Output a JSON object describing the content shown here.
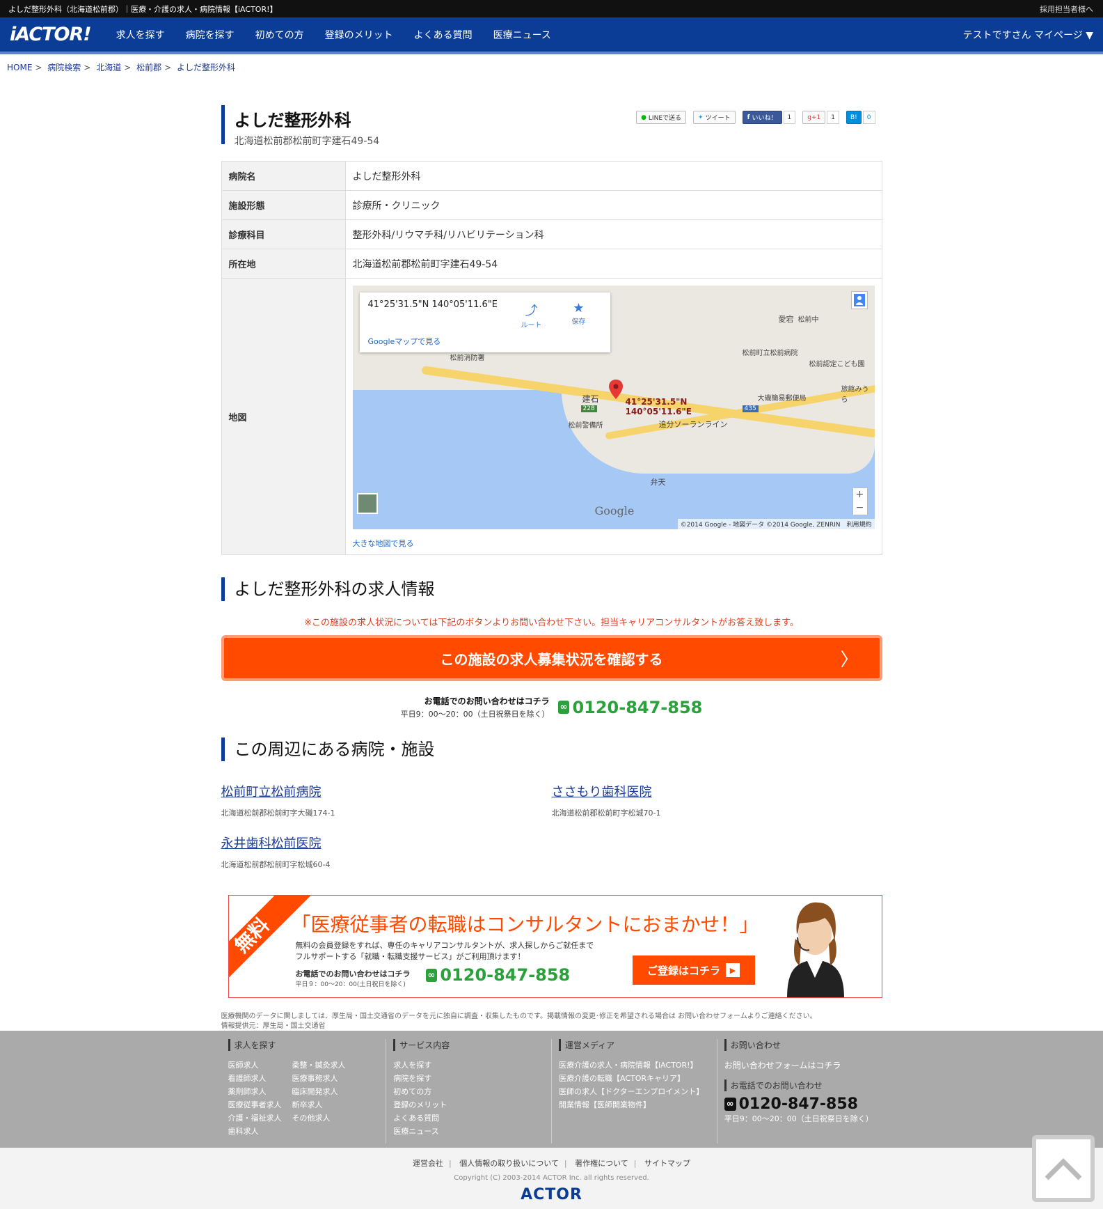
{
  "topbar": {
    "title": "よしだ整形外科（北海道松前郡）｜医療・介護の求人・病院情報【iACTOR!】",
    "employer_link": "採用担当者様へ"
  },
  "header": {
    "logo": "iACTOR!",
    "nav": [
      "求人を探す",
      "病院を探す",
      "初めての方",
      "登録のメリット",
      "よくある質問",
      "医療ニュース"
    ],
    "user_menu": "テストですさん マイページ ▼"
  },
  "breadcrumb": [
    "HOME",
    "病院検索",
    "北海道",
    "松前郡",
    "よしだ整形外科"
  ],
  "share": {
    "line": "LINEで送る",
    "tweet": "ツイート",
    "like": "いいね！",
    "like_count": "1",
    "gplus": "g+1",
    "gplus_count": "1",
    "hatena": "B!",
    "hatena_count": "0"
  },
  "hospital": {
    "name": "よしだ整形外科",
    "address": "北海道松前郡松前町字建石49-54"
  },
  "info_table": {
    "rows": [
      {
        "label": "病院名",
        "value": "よしだ整形外科"
      },
      {
        "label": "施設形態",
        "value": "診療所・クリニック"
      },
      {
        "label": "診療科目",
        "value": "整形外科/リウマチ科/リハビリテーション科"
      },
      {
        "label": "所在地",
        "value": "北海道松前郡松前町字建石49-54"
      }
    ],
    "map_label": "地図"
  },
  "map": {
    "coord": "41°25'31.5\"N 140°05'11.6\"E",
    "pin_line1": "41°25'31.5\"N",
    "pin_line2": "140°05'11.6\"E",
    "route": "ルート",
    "save": "保存",
    "google_link": "Googleマップで見る",
    "google": "Google",
    "copyright": "©2014 Google - 地図データ ©2014 Google, ZENRIN　利用規約",
    "big_map_link": "大きな地図で見る",
    "places": [
      "松前消防署",
      "建石",
      "228",
      "松前警備所",
      "追分ソーランライン",
      "大磯簡易郵便局",
      "435",
      "愛宕",
      "松前中",
      "松前町立松前病院",
      "松前認定こども園",
      "旅館みうら",
      "弁天"
    ]
  },
  "jobs": {
    "title": "よしだ整形外科の求人情報",
    "notice": "※この施設の求人状況については下記のボタンよりお問い合わせ下さい。担当キャリアコンサルタントがお答え致します。",
    "cta": "この施設の求人募集状況を確認する",
    "phone_label": "お電話でのお問い合わせはコチラ",
    "phone_hours": "平日9：00～20：00（土日祝祭日を除く）",
    "phone_number": "0120-847-858",
    "freedial": "∞"
  },
  "nearby": {
    "title": "この周辺にある病院・施設",
    "items": [
      {
        "name": "松前町立松前病院",
        "address": "北海道松前郡松前町字大磯174-1"
      },
      {
        "name": "ささもり歯科医院",
        "address": "北海道松前郡松前町字松城70-1"
      },
      {
        "name": "永井歯科松前医院",
        "address": "北海道松前郡松前町字松城60-4"
      }
    ]
  },
  "banner": {
    "ribbon": "無料",
    "headline": "「医療従事者の転職はコンサルタントにおまかせ！」",
    "desc1": "無料の会員登録をすれば、専任のキャリアコンサルタントが、求人探しからご就任まで",
    "desc2": "フルサポートする「就職・転職支援サービス」がご利用頂けます！",
    "phone_label": "お電話でのお問い合わせはコチラ",
    "phone_hours": "平日９：00～20：00(土日祝日を除く)",
    "phone_number": "0120-847-858",
    "register": "ご登録はコチラ"
  },
  "disclaimer": {
    "line1": "医療機関のデータに関しましては、厚生局・国土交通省のデータを元に独自に調査・収集したものです。掲載情報の変更･修正を希望される場合は お問い合わせフォームよりご連絡ください。",
    "line2": "情報提供元：厚生局・国土交通省"
  },
  "footer": {
    "col1": {
      "title": "求人を探す",
      "links": [
        "医師求人",
        "柔整・鍼灸求人",
        "看護師求人",
        "医療事務求人",
        "薬剤師求人",
        "臨床開発求人",
        "医療従事者求人",
        "新卒求人",
        "介護・福祉求人",
        "その他求人",
        "歯科求人"
      ]
    },
    "col2": {
      "title": "サービス内容",
      "links": [
        "求人を探す",
        "病院を探す",
        "初めての方",
        "登録のメリット",
        "よくある質問",
        "医療ニュース"
      ]
    },
    "col3": {
      "title": "運営メディア",
      "links": [
        "医療介護の求人・病院情報【iACTOR!】",
        "医療介護の転職【ACTORキャリア】",
        "医師の求人【ドクターエンプロイメント】",
        "開業情報【医師開業物件】"
      ]
    },
    "col4": {
      "title": "お問い合わせ",
      "form_link": "お問い合わせフォームはコチラ",
      "phone_title": "お電話でのお問い合わせ",
      "phone_number": "0120-847-858",
      "hours": "平日9：00～20：00（土日祝祭日を除く）"
    }
  },
  "subfooter": {
    "links": [
      "運営会社",
      "個人情報の取り扱いについて",
      "著作権について",
      "サイトマップ"
    ],
    "copyright": "Copyright (C) 2003-2014 ACTOR Inc. all rights reserved.",
    "logo": "ACTOR"
  },
  "colors": {
    "brand_blue": "#0c3d96",
    "cta_orange": "#ff4a00",
    "phone_green": "#2aa13b",
    "notice_red": "#e33b1d"
  }
}
